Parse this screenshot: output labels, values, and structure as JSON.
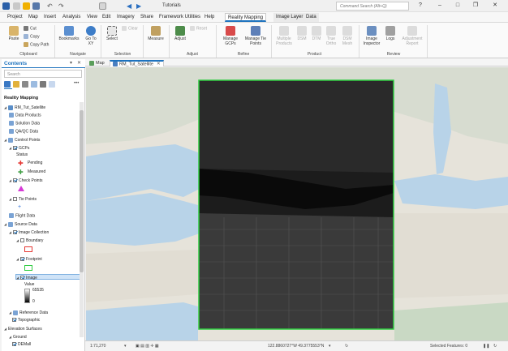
{
  "window": {
    "project_name": "Tutorials",
    "search_placeholder": "Command Search (Alt+Q)"
  },
  "tabs": [
    "Project",
    "Map",
    "Insert",
    "Analysis",
    "View",
    "Edit",
    "Imagery",
    "Share",
    "Framework Utilities",
    "Help",
    "Reality Mapping",
    "Image Layer",
    "Data"
  ],
  "active_tab": "Reality Mapping",
  "ribbon": {
    "clipboard": {
      "paste": "Paste",
      "cut": "Cut",
      "copy": "Copy",
      "copy_path": "Copy Path",
      "label": "Clipboard"
    },
    "navigate": {
      "bookmarks": "Bookmarks",
      "goto": "Go To XY",
      "label": "Navigate"
    },
    "selection": {
      "select": "Select",
      "clear": "Clear",
      "label": "Selection"
    },
    "inquiry": {
      "measure": "Measure"
    },
    "adjust": {
      "adjust": "Adjust",
      "reset": "Reset",
      "label": "Adjust"
    },
    "refine": {
      "manage_gcps": "Manage GCPs",
      "manage_tie_points": "Manage Tie Points",
      "label": "Refine"
    },
    "product": {
      "multiple": "Multiple Products",
      "dsm": "DSM",
      "dtm": "DTM",
      "true_ortho": "True Ortho",
      "dsm_mesh": "DSM Mesh",
      "label": "Product"
    },
    "review": {
      "image_inspector": "Image Inspector",
      "logs": "Logs",
      "adjustment_report": "Adjustment Report",
      "label": "Review"
    }
  },
  "contents": {
    "title": "Contents",
    "search_placeholder": "Search",
    "heading": "Reality Mapping",
    "items": {
      "workspace": "RM_Tut_Satellite",
      "data_products": "Data Products",
      "solution_data": "Solution Data",
      "qa_qc": "QA/QC Data",
      "control_points": "Control Points",
      "gcps": "GCPs",
      "status": "Status",
      "pending": "Pending",
      "measured": "Measured",
      "check_points": "Check Points",
      "tie_points": "Tie Points",
      "flight_data": "Flight Data",
      "source_data": "Source Data",
      "image_collection": "Image Collection",
      "boundary": "Boundary",
      "footprint": "Footprint",
      "image": "Image",
      "value": "Value",
      "value_max": "65535",
      "value_min": "0",
      "reference_data": "Reference Data",
      "topographic": "Topographic",
      "elevation_surfaces": "Elevation Surfaces",
      "ground": "Ground",
      "dem": "DEMall"
    }
  },
  "view_tabs": [
    "Map",
    "RM_Tut_Satellite"
  ],
  "status": {
    "scale": "1:71,270",
    "coordinates": "122.8860727°W 49.3775553°N",
    "selected": "Selected Features: 0"
  },
  "colors": {
    "accent": "#1e73be",
    "footprint": "#2ecc40",
    "pending": "#e53935",
    "measured": "#43a047",
    "check": "#d63ad6",
    "tie": "#2b6cd6"
  }
}
